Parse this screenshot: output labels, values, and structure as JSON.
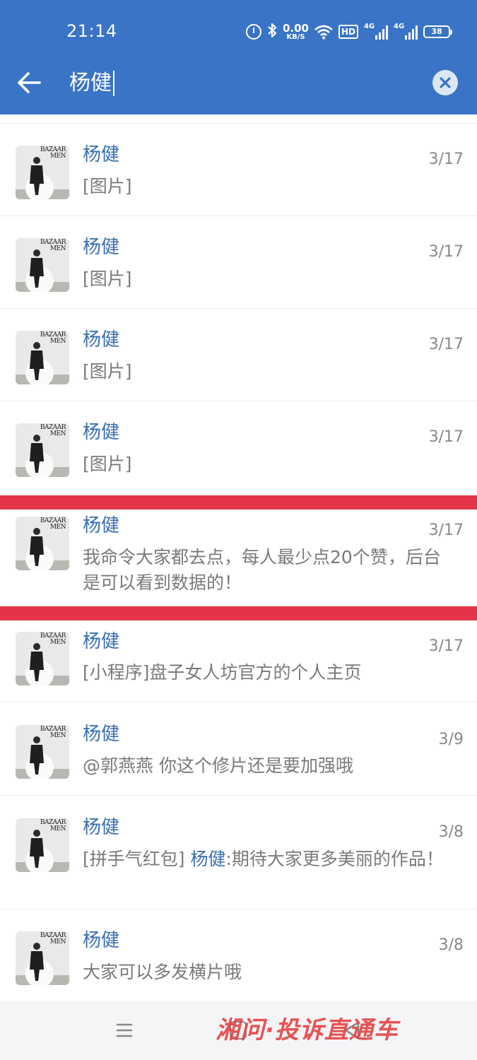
{
  "status_bar": {
    "time": "21:14",
    "net_speed_value": "0.00",
    "net_speed_unit": "KB/S",
    "hd_label": "HD",
    "sim1_label": "4G",
    "sim2_label": "4G",
    "battery": "38"
  },
  "search": {
    "query": "杨健"
  },
  "results": [
    {
      "name": "杨健",
      "date": "3/17",
      "message": "[图片]"
    },
    {
      "name": "杨健",
      "date": "3/17",
      "message": "[图片]"
    },
    {
      "name": "杨健",
      "date": "3/17",
      "message": "[图片]"
    },
    {
      "name": "杨健",
      "date": "3/17",
      "message": "[图片]"
    },
    {
      "name": "杨健",
      "date": "3/17",
      "message_line1": "我命令大家都去点，每人最少点20个赞，后台",
      "message_line2": "是可以看到数据的！"
    },
    {
      "name": "杨健",
      "date": "3/17",
      "message": "[小程序]盘子女人坊官方的个人主页"
    },
    {
      "name": "杨健",
      "date": "3/9",
      "message": "@郭燕燕 你这个修片还是要加强哦"
    },
    {
      "name": "杨健",
      "date": "3/8",
      "message_prefix": "[拼手气红包] ",
      "message_sender": "杨健",
      "message_rest": ":期待大家更多美丽的作品！"
    },
    {
      "name": "杨健",
      "date": "3/8",
      "message": "大家可以多发横片哦"
    }
  ],
  "avatar_caption": {
    "line1": "BAZAAR",
    "line2": "MEN"
  },
  "watermark": "湘问·投诉直通车",
  "colors": {
    "header": "#3a74c6",
    "name": "#3a6fb2",
    "highlight_bar": "#e53447",
    "meta_text": "#888888"
  }
}
